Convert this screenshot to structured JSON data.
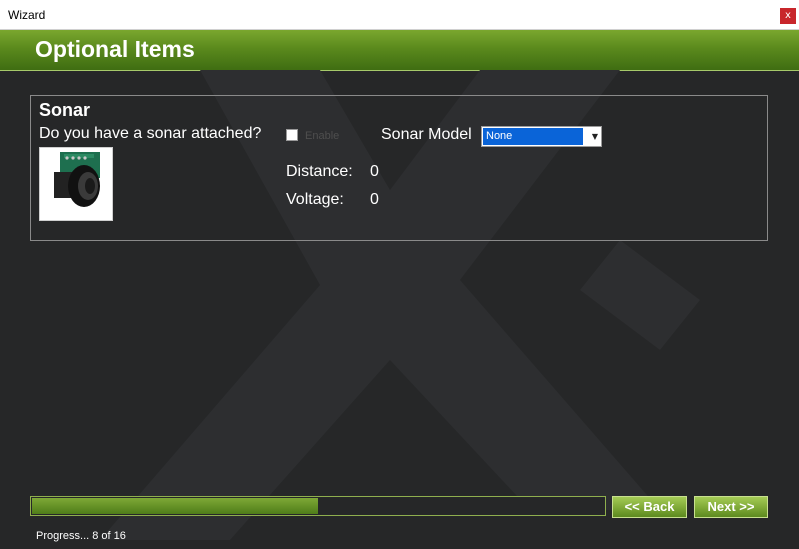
{
  "window": {
    "title": "Wizard",
    "close_label": "x"
  },
  "header": {
    "title": "Optional Items"
  },
  "sonar": {
    "section_title": "Sonar",
    "question": "Do you have a sonar attached?",
    "enable_label": "Enable",
    "enable_checked": false,
    "model_label": "Sonar Model",
    "model_value": "None",
    "distance_label": "Distance:",
    "distance_value": "0",
    "voltage_label": "Voltage:",
    "voltage_value": "0"
  },
  "footer": {
    "back_label": "<< Back",
    "next_label": "Next >>",
    "progress_text": "Progress... 8 of 16",
    "progress_fraction": 0.5
  },
  "colors": {
    "accent": "#5b8a1d",
    "background": "#262728",
    "selection": "#0a64d8",
    "close": "#c8262b"
  },
  "icons": {
    "close": "close-icon",
    "dropdown": "chevron-down-icon",
    "sensor": "sonar-sensor-image"
  }
}
